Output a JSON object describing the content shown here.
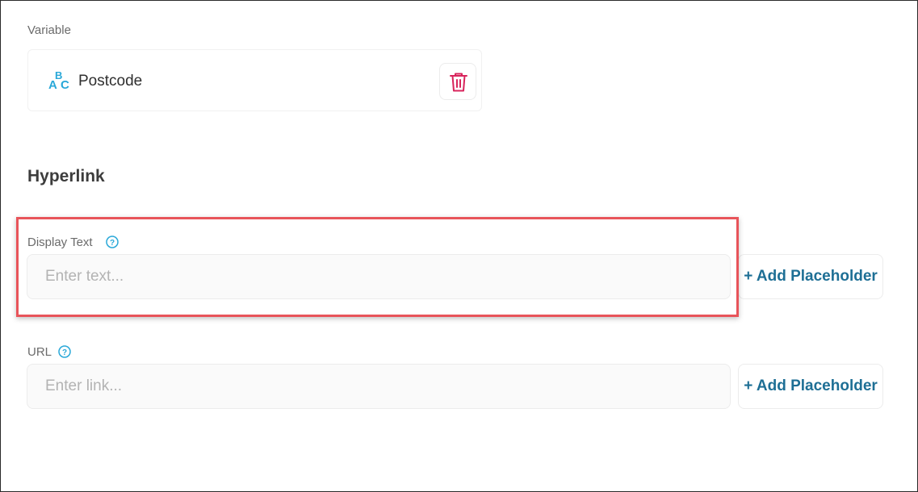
{
  "variable": {
    "label": "Variable",
    "name": "Postcode",
    "type_icon": "abc-text-type-icon",
    "delete_icon": "trash-icon"
  },
  "hyperlink": {
    "title": "Hyperlink",
    "display_text": {
      "label": "Display Text",
      "placeholder": "Enter text...",
      "value": "",
      "help_icon": "help-circle-icon",
      "add_placeholder_label": "+ Add Placeholder"
    },
    "url": {
      "label": "URL",
      "placeholder": "Enter link...",
      "value": "",
      "help_icon": "help-circle-icon",
      "add_placeholder_label": "+ Add Placeholder"
    }
  },
  "colors": {
    "accent": "#1e6f95",
    "icon_cyan": "#29a8d8",
    "delete_red": "#d8255c",
    "highlight": "#e8545a"
  }
}
